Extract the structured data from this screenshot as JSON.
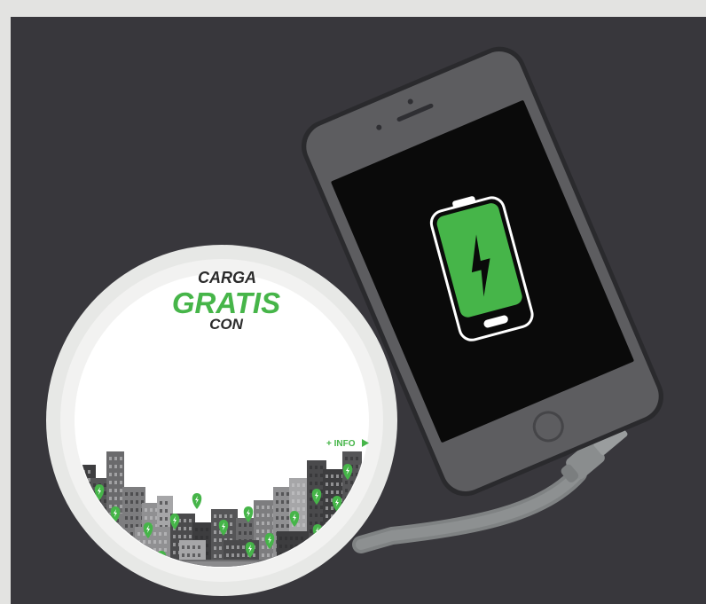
{
  "headline": {
    "line1": "CARGA",
    "line2": "GRATIS",
    "line3": "CON"
  },
  "info_link": "+ INFO",
  "colors": {
    "background": "#38373c",
    "accent_green": "#46b549",
    "phone_body": "#5d5d60",
    "screen": "#0a0a0a",
    "pad_ring": "#e7e8e6",
    "text_dark": "#2b2b2b"
  },
  "icons": {
    "battery": "battery-charging-icon",
    "bolt": "lightning-bolt-icon",
    "pin": "charging-location-pin-icon"
  },
  "battery_level": 1.0
}
